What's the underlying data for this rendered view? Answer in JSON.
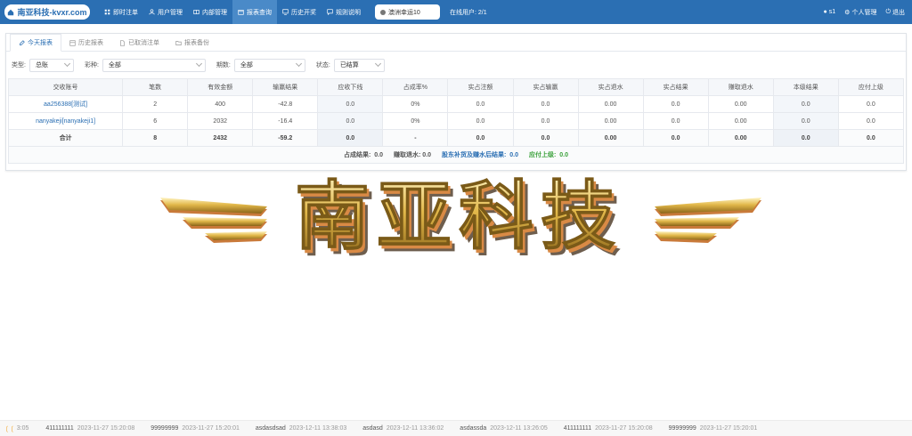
{
  "header": {
    "logo_text": "南亚科技-kvxr.com",
    "nav": [
      {
        "label": "即时注单",
        "icon": "grid-icon"
      },
      {
        "label": "用户管理",
        "icon": "user-icon"
      },
      {
        "label": "内部管理",
        "icon": "book-icon"
      },
      {
        "label": "报表查询",
        "icon": "calendar-icon",
        "active": true
      },
      {
        "label": "历史开奖",
        "icon": "monitor-icon"
      },
      {
        "label": "规则说明",
        "icon": "chat-icon"
      }
    ],
    "lottery": "澳洲幸运10",
    "online_users": "在线用户: 2/1",
    "user": "s1",
    "profile": "个人管理",
    "logout": "退出"
  },
  "tabs": [
    {
      "label": "今天报表",
      "active": true
    },
    {
      "label": "历史报表"
    },
    {
      "label": "已取消注单"
    },
    {
      "label": "报表备份"
    }
  ],
  "filters": {
    "type_label": "类型:",
    "type_value": "总账",
    "game_label": "彩种:",
    "game_value": "全部",
    "period_label": "期数:",
    "period_value": "全部",
    "status_label": "状态:",
    "status_value": "已结算"
  },
  "table": {
    "headers": [
      "交收账号",
      "笔数",
      "有效金额",
      "输赢结果",
      "应收下线",
      "占成率%",
      "实占注额",
      "实占输赢",
      "实占退水",
      "实占结果",
      "赚取退水",
      "本级结果",
      "应付上级"
    ],
    "rows": [
      [
        "aa256388[测试]",
        "2",
        "400",
        "-42.8",
        "0.0",
        "0%",
        "0.0",
        "0.0",
        "0.00",
        "0.0",
        "0.00",
        "0.0",
        "0.0"
      ],
      [
        "nanyakeji[nanyakeji1]",
        "6",
        "2032",
        "-16.4",
        "0.0",
        "0%",
        "0.0",
        "0.0",
        "0.00",
        "0.0",
        "0.00",
        "0.0",
        "0.0"
      ]
    ],
    "total": [
      "合计",
      "8",
      "2432",
      "-59.2",
      "0.0",
      "-",
      "0.0",
      "0.0",
      "0.00",
      "0.0",
      "0.00",
      "0.0",
      "0.0"
    ],
    "summary": {
      "zhancheng_label": "占成结果:",
      "zhancheng_value": "0.0",
      "zhuanqu_label": "赚取退水:",
      "zhuanqu_value": "0.0",
      "after_label": "股东补货及赚水后结果:",
      "after_value": "0.0",
      "payable_label": "应付上级:",
      "payable_value": "0.0"
    }
  },
  "banner_text": "南亚科技",
  "ticker": {
    "lead_time": "3:05",
    "items": [
      {
        "user": "411111111",
        "date": "2023-11-27 15:20:08"
      },
      {
        "user": "99999999",
        "date": "2023-11-27 15:20:01"
      },
      {
        "user": "asdasdsad",
        "date": "2023-12-11 13:38:03"
      },
      {
        "user": "asdasd",
        "date": "2023-12-11 13:36:02"
      },
      {
        "user": "asdassda",
        "date": "2023-12-11 13:26:05"
      },
      {
        "user": "411111111",
        "date": "2023-11-27 15:20:08"
      },
      {
        "user": "99999999",
        "date": "2023-11-27 15:20:01"
      }
    ]
  },
  "colors": {
    "brand": "#2b6fb3",
    "active_nav": "#4a8ac8",
    "green": "#3aa13a"
  }
}
